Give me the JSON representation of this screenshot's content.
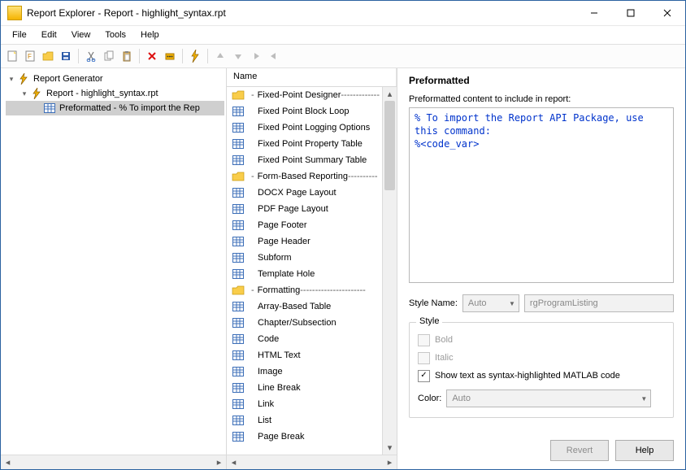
{
  "window": {
    "title": "Report Explorer - Report - highlight_syntax.rpt"
  },
  "menubar": [
    "File",
    "Edit",
    "View",
    "Tools",
    "Help"
  ],
  "tree": {
    "root": "Report Generator",
    "report": "Report - highlight_syntax.rpt",
    "child": "Preformatted - % To import the Rep"
  },
  "list": {
    "header": "Name",
    "items": [
      {
        "icon": "folder",
        "text": "Fixed-Point Designer",
        "trail": "-------------",
        "dash": true
      },
      {
        "icon": "table",
        "text": "Fixed Point Block Loop"
      },
      {
        "icon": "table",
        "text": "Fixed Point Logging Options"
      },
      {
        "icon": "table",
        "text": "Fixed Point Property Table"
      },
      {
        "icon": "table",
        "text": "Fixed Point Summary Table"
      },
      {
        "icon": "folder",
        "text": "Form-Based Reporting",
        "trail": "----------",
        "dash": true
      },
      {
        "icon": "table",
        "text": "DOCX Page Layout"
      },
      {
        "icon": "table",
        "text": "PDF Page Layout"
      },
      {
        "icon": "table",
        "text": "Page Footer"
      },
      {
        "icon": "table",
        "text": "Page Header"
      },
      {
        "icon": "table",
        "text": "Subform"
      },
      {
        "icon": "table",
        "text": "Template Hole"
      },
      {
        "icon": "folder",
        "text": "Formatting",
        "trail": "----------------------",
        "dash": true
      },
      {
        "icon": "table",
        "text": "Array-Based Table"
      },
      {
        "icon": "table",
        "text": "Chapter/Subsection"
      },
      {
        "icon": "table",
        "text": "Code"
      },
      {
        "icon": "table",
        "text": "HTML Text"
      },
      {
        "icon": "table",
        "text": "Image"
      },
      {
        "icon": "table",
        "text": "Line Break"
      },
      {
        "icon": "table",
        "text": "Link"
      },
      {
        "icon": "table",
        "text": "List"
      },
      {
        "icon": "table",
        "text": "Page Break"
      }
    ]
  },
  "props": {
    "title": "Preformatted",
    "content_label": "Preformatted content to include in report:",
    "content_line1": "% To import the Report API Package, use this command:",
    "content_line2": "%<code_var>",
    "style_name_label": "Style Name:",
    "style_name_mode": "Auto",
    "style_name_value": "rgProgramListing",
    "style_group": "Style",
    "bold_label": "Bold",
    "italic_label": "Italic",
    "syntax_label": "Show text as syntax-highlighted MATLAB code",
    "color_label": "Color:",
    "color_value": "Auto",
    "revert": "Revert",
    "help": "Help"
  }
}
